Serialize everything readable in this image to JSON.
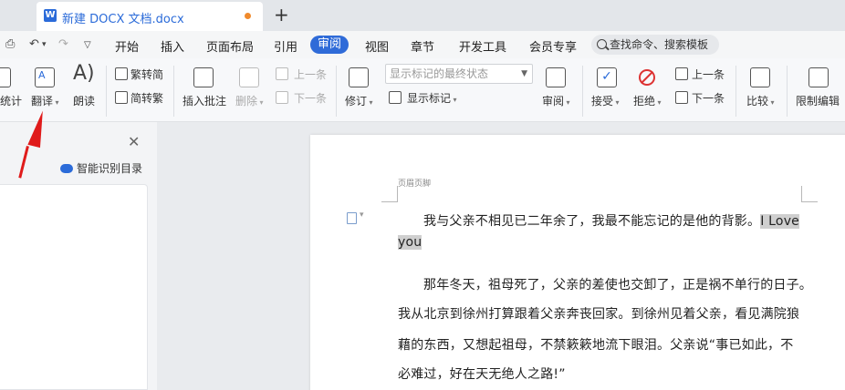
{
  "tab": {
    "title": "新建 DOCX 文档.docx",
    "icon": "W"
  },
  "menu": {
    "items": [
      "开始",
      "插入",
      "页面布局",
      "引用",
      "审阅",
      "视图",
      "章节",
      "开发工具",
      "会员专享"
    ],
    "active": "审阅",
    "search_placeholder": "查找命令、搜索模板"
  },
  "ribbon": {
    "word_count": "统计",
    "translate": "翻译",
    "read_aloud": "朗读",
    "trad_to_simp": "繁转简",
    "simp_to_trad": "简转繁",
    "insert_comment": "插入批注",
    "delete": "删除",
    "prev_comment": "上一条",
    "next_comment": "下一条",
    "track_changes": "修订",
    "markup_select_value": "显示标记的最终状态",
    "show_markup": "显示标记",
    "review": "审阅",
    "accept": "接受",
    "reject": "拒绝",
    "prev_change": "上一条",
    "next_change": "下一条",
    "compare": "比较",
    "restrict_editing": "限制编辑"
  },
  "leftpane": {
    "toc_button": "智能识别目录"
  },
  "document": {
    "header_label": "页眉页脚",
    "para1_text": "我与父亲不相见已二年余了，我最不能忘记的是他的背影。",
    "para1_highlight_a": "I Love",
    "para1_highlight_b": "you",
    "para2_line1": "那年冬天，祖母死了，父亲的差使也交卸了，正是祸不单行的日子。",
    "para2_line2": "我从北京到徐州打算跟着父亲奔丧回家。到徐州见着父亲，看见满院狼",
    "para2_line3": "藉的东西，又想起祖母，不禁簌簌地流下眼泪。父亲说“事已如此，不",
    "para2_line4": "必难过，好在天无绝人之路!”"
  }
}
